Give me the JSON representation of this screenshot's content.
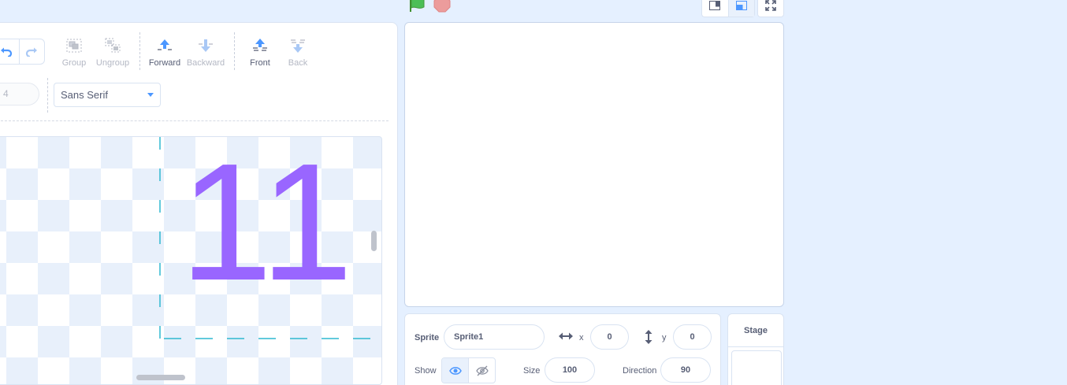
{
  "paint_editor": {
    "tools": {
      "group": "Group",
      "ungroup": "Ungroup",
      "forward": "Forward",
      "backward": "Backward",
      "front": "Front",
      "back": "Back"
    },
    "stroke_width": "4",
    "font": "Sans Serif",
    "canvas_text": "11",
    "text_color": "#9966ff",
    "accent_color": "#4c97ff"
  },
  "sprite_info": {
    "sprite_label": "Sprite",
    "sprite_name": "Sprite1",
    "x_label": "x",
    "x_value": "0",
    "y_label": "y",
    "y_value": "0",
    "show_label": "Show",
    "size_label": "Size",
    "size_value": "100",
    "direction_label": "Direction",
    "direction_value": "90"
  },
  "stage_selector": {
    "title": "Stage"
  },
  "icons": [
    "undo-icon",
    "redo-icon",
    "group-icon",
    "ungroup-icon",
    "forward-icon",
    "backward-icon",
    "front-icon",
    "back-icon",
    "green-flag-icon",
    "stop-icon",
    "small-stage-icon",
    "large-stage-icon",
    "fullscreen-icon",
    "horizontal-arrows-icon",
    "vertical-arrows-icon",
    "eye-icon",
    "eye-hidden-icon"
  ]
}
